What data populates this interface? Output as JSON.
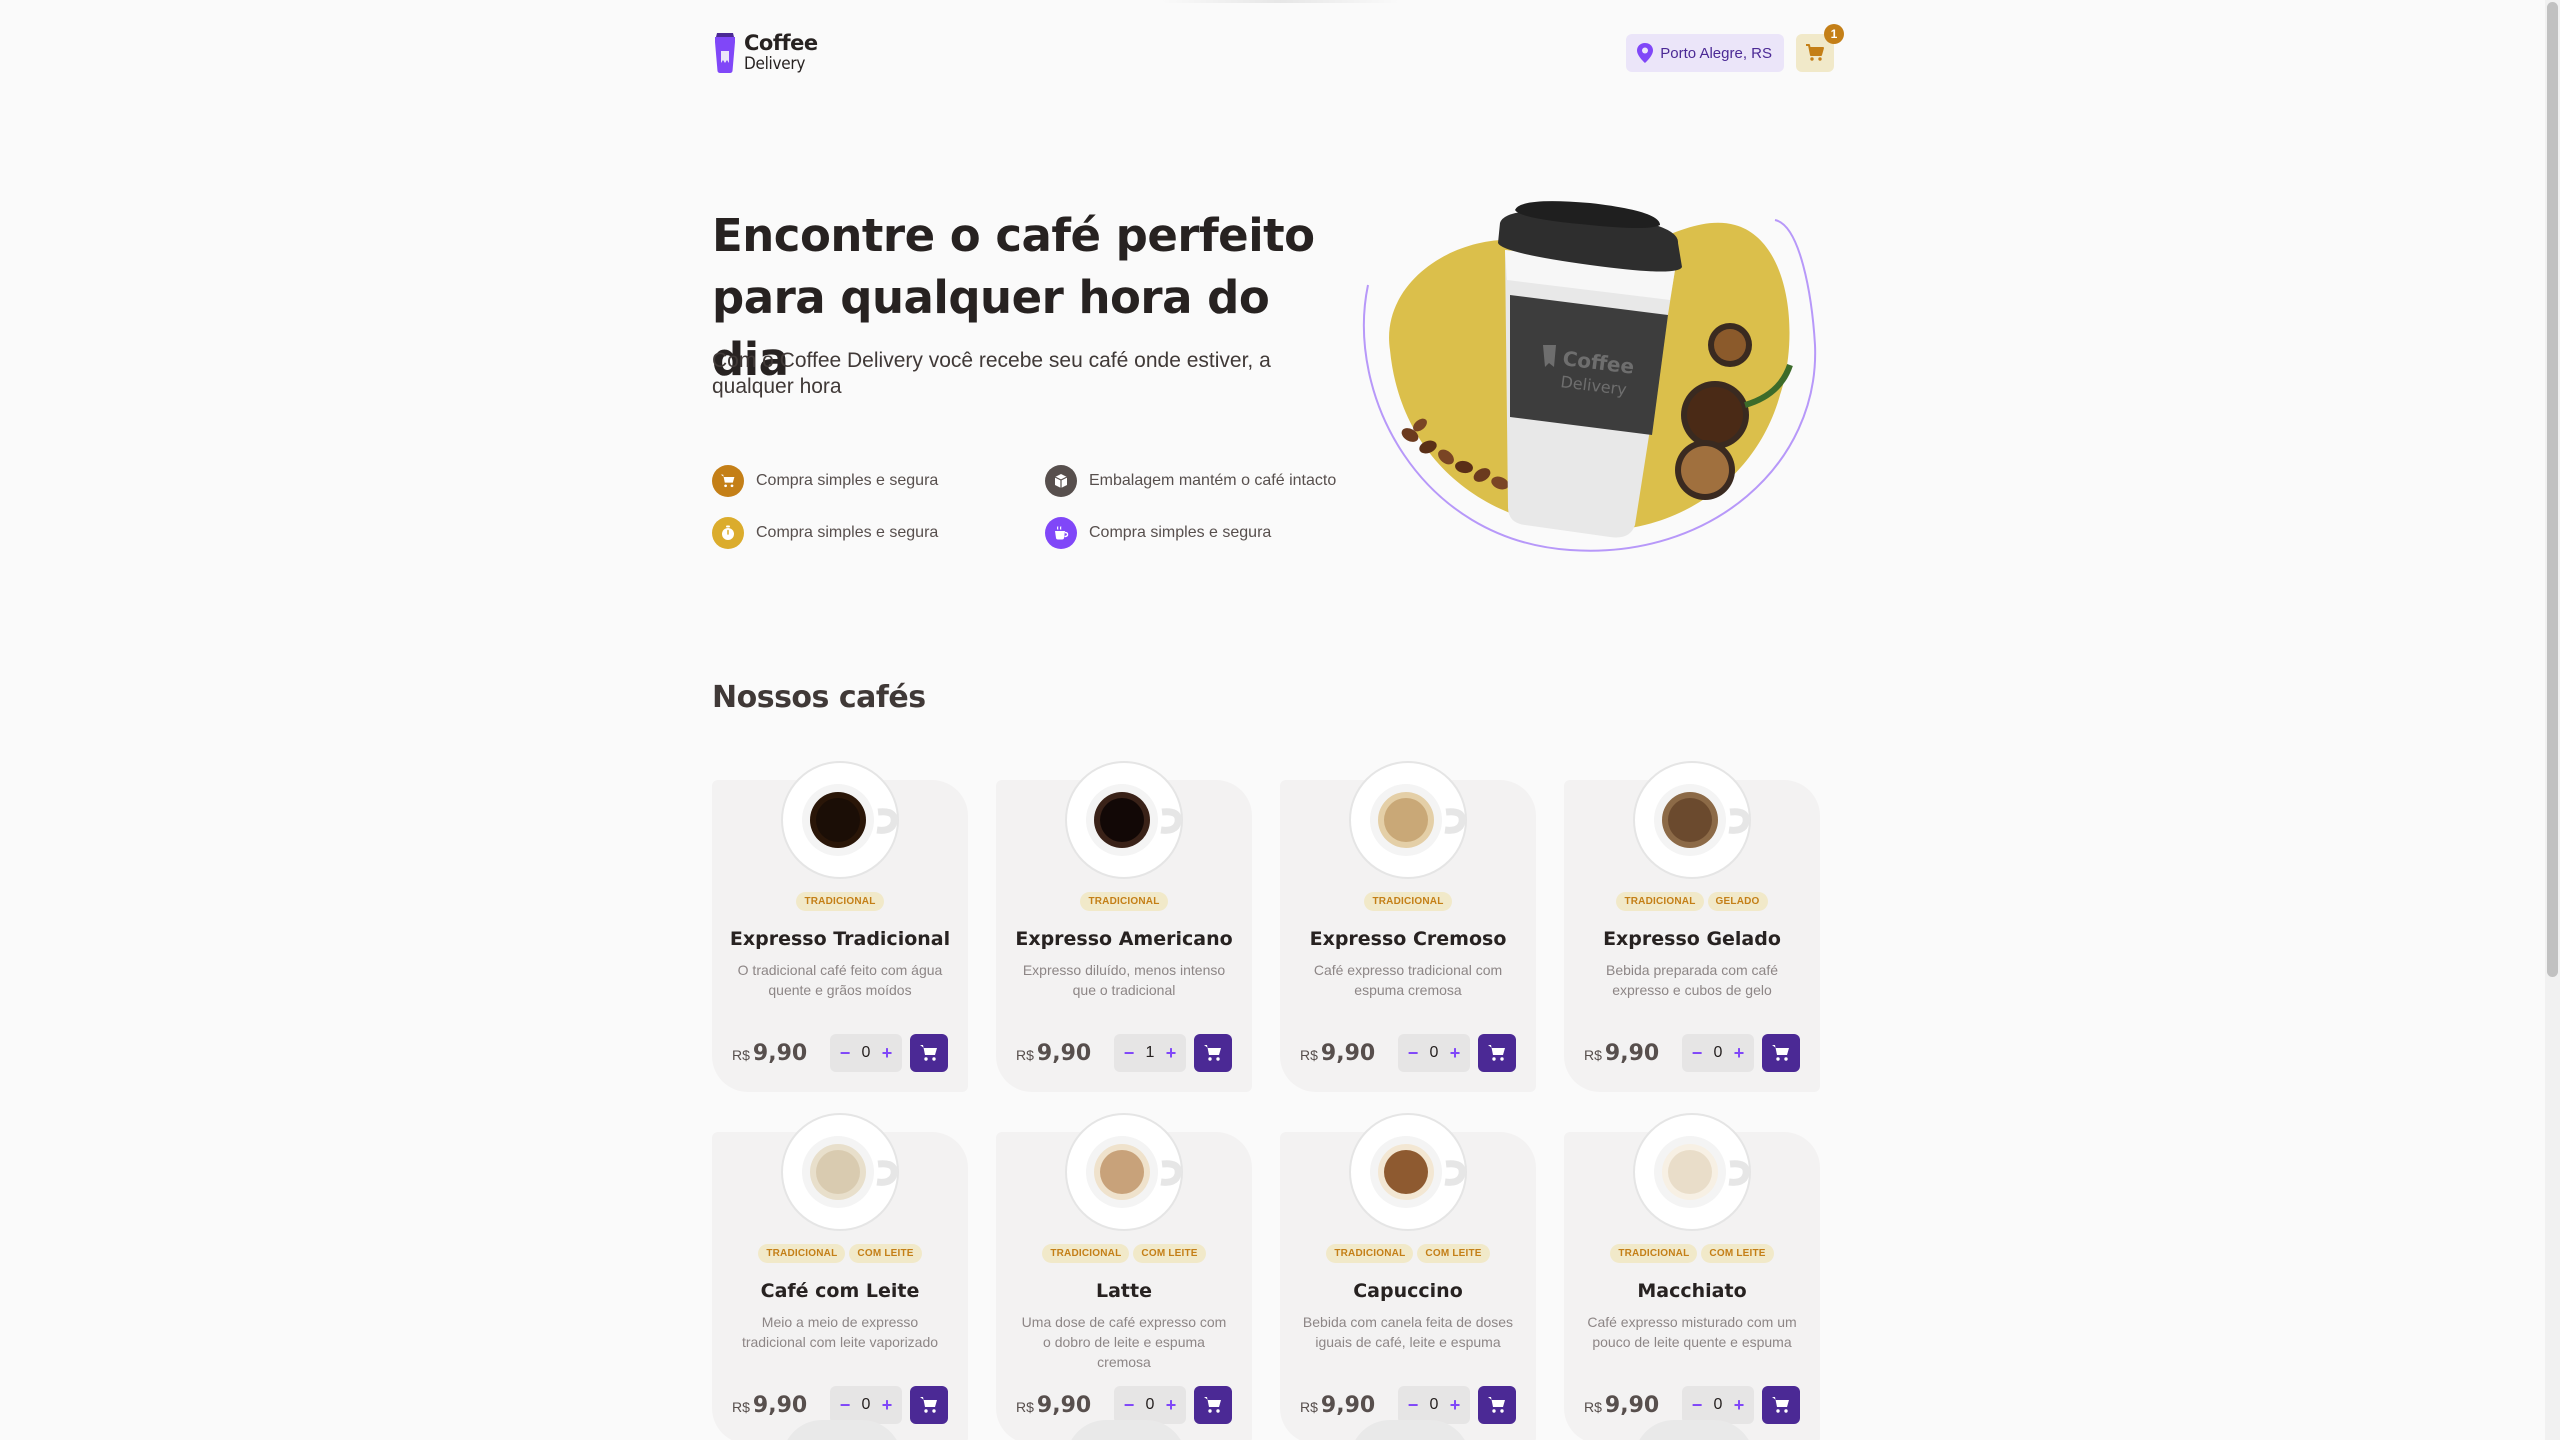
{
  "header": {
    "logo_line1": "Coffee",
    "logo_line2": "Delivery",
    "location": "Porto Alegre, RS",
    "cart_count": "1"
  },
  "hero": {
    "title": "Encontre o café perfeito para qualquer hora do dia",
    "subtitle": "Com o Coffee Delivery você recebe seu café onde estiver, a qualquer hora",
    "features": [
      {
        "label": "Compra simples e segura",
        "icon": "cart-icon",
        "color": "#C47F17"
      },
      {
        "label": "Embalagem mantém o café intacto",
        "icon": "package-icon",
        "color": "#574F4D"
      },
      {
        "label": "Compra simples e segura",
        "icon": "timer-icon",
        "color": "#DBAC2C"
      },
      {
        "label": "Compra simples e segura",
        "icon": "coffee-icon",
        "color": "#8047F8"
      }
    ]
  },
  "section": {
    "title": "Nossos cafés"
  },
  "currency": "R$",
  "coffees": [
    {
      "name": "Expresso Tradicional",
      "description": "O tradicional café feito com água quente e grãos moídos",
      "tags": [
        "Tradicional"
      ],
      "price": "9,90",
      "qty": "0"
    },
    {
      "name": "Expresso Americano",
      "description": "Expresso diluído, menos intenso que o tradicional",
      "tags": [
        "Tradicional"
      ],
      "price": "9,90",
      "qty": "1"
    },
    {
      "name": "Expresso Cremoso",
      "description": "Café expresso tradicional com espuma cremosa",
      "tags": [
        "Tradicional"
      ],
      "price": "9,90",
      "qty": "0"
    },
    {
      "name": "Expresso Gelado",
      "description": "Bebida preparada com café expresso e cubos de gelo",
      "tags": [
        "Tradicional",
        "Gelado"
      ],
      "price": "9,90",
      "qty": "0"
    },
    {
      "name": "Café com Leite",
      "description": "Meio a meio de expresso tradicional com leite vaporizado",
      "tags": [
        "Tradicional",
        "Com leite"
      ],
      "price": "9,90",
      "qty": "0"
    },
    {
      "name": "Latte",
      "description": "Uma dose de café expresso com o dobro de leite e espuma cremosa",
      "tags": [
        "Tradicional",
        "Com leite"
      ],
      "price": "9,90",
      "qty": "0"
    },
    {
      "name": "Capuccino",
      "description": "Bebida com canela feita de doses iguais de café, leite e espuma",
      "tags": [
        "Tradicional",
        "Com leite"
      ],
      "price": "9,90",
      "qty": "0"
    },
    {
      "name": "Macchiato",
      "description": "Café expresso misturado com um pouco de leite quente e espuma",
      "tags": [
        "Tradicional",
        "Com leite"
      ],
      "price": "9,90",
      "qty": "0"
    }
  ],
  "colors": {
    "purple_dark": "#4B2995",
    "purple": "#8047F8",
    "yellow_dark": "#C47F17",
    "yellow": "#DBAC2C",
    "yellow_light": "#F1E9C9"
  }
}
